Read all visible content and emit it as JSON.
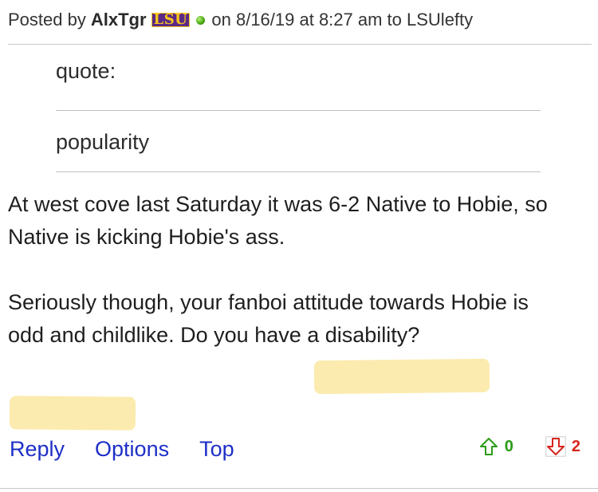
{
  "header": {
    "posted_by": "Posted by",
    "author": "AlxTgr",
    "badge_text": "LSU",
    "badge_color": "#5b2a86",
    "badge_accent": "#f6c31d",
    "online_indicator": "green-dot-icon",
    "meta": "on 8/16/19 at 8:27 am to LSUlefty"
  },
  "quote": {
    "label": "quote:",
    "text": "popularity"
  },
  "body": {
    "paragraph1": "At west cove last Saturday it was 6-2 Native to Hobie, so Native is kicking Hobie's ass.",
    "paragraph2": "Seriously though, your fanboi attitude towards Hobie is odd and childlike. Do you have a disability?"
  },
  "actions": {
    "reply": "Reply",
    "options": "Options",
    "top": "Top"
  },
  "votes": {
    "up_icon": "arrow-up-icon",
    "up_count": "0",
    "up_color": "#2b9b17",
    "down_icon": "arrow-down-icon",
    "down_count": "2",
    "down_color": "#d6261d"
  },
  "colors": {
    "link": "#1d2fc7",
    "highlight": "#fbe9a6"
  }
}
